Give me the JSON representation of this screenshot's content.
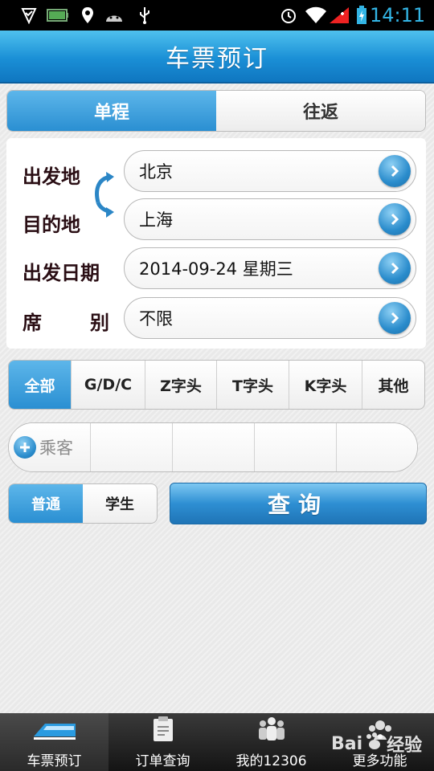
{
  "status_bar": {
    "time": "14:11",
    "icons": [
      "shield-check-icon",
      "battery-90-icon",
      "location-icon",
      "android-icon",
      "usb-icon",
      "alarm-icon",
      "wifi-icon",
      "signal-icon",
      "charging-icon"
    ],
    "battery_label": "90",
    "accent_color": "#33b5e5"
  },
  "header": {
    "title": "车票预订"
  },
  "trip_type": {
    "one_way": "单程",
    "round_trip": "往返",
    "selected": "单程"
  },
  "form": {
    "from_label": "出发地",
    "to_label": "目的地",
    "date_label": "出发日期",
    "seat_label_1": "席",
    "seat_label_2": "别",
    "from_value": "北京",
    "to_value": "上海",
    "date_value": "2014-09-24 星期三",
    "seat_value": "不限"
  },
  "train_types": {
    "items": [
      "全部",
      "G/D/C",
      "Z字头",
      "T字头",
      "K字头",
      "其他"
    ],
    "selected": "全部"
  },
  "passengers": {
    "add_label": "乘客"
  },
  "ticket_type": {
    "normal": "普通",
    "student": "学生",
    "selected": "普通"
  },
  "query_button": {
    "label": "查询"
  },
  "tabs": [
    {
      "label": "车票预订",
      "icon": "train-icon",
      "active": true
    },
    {
      "label": "订单查询",
      "icon": "clipboard-icon",
      "active": false
    },
    {
      "label": "我的12306",
      "icon": "people-icon",
      "active": false
    },
    {
      "label": "更多功能",
      "icon": "more-icon",
      "active": false
    }
  ],
  "watermark": {
    "text": "Bai",
    "suffix": "经验"
  },
  "colors": {
    "brand_blue": "#1a8fd6",
    "label_dark": "#2a0e14"
  }
}
